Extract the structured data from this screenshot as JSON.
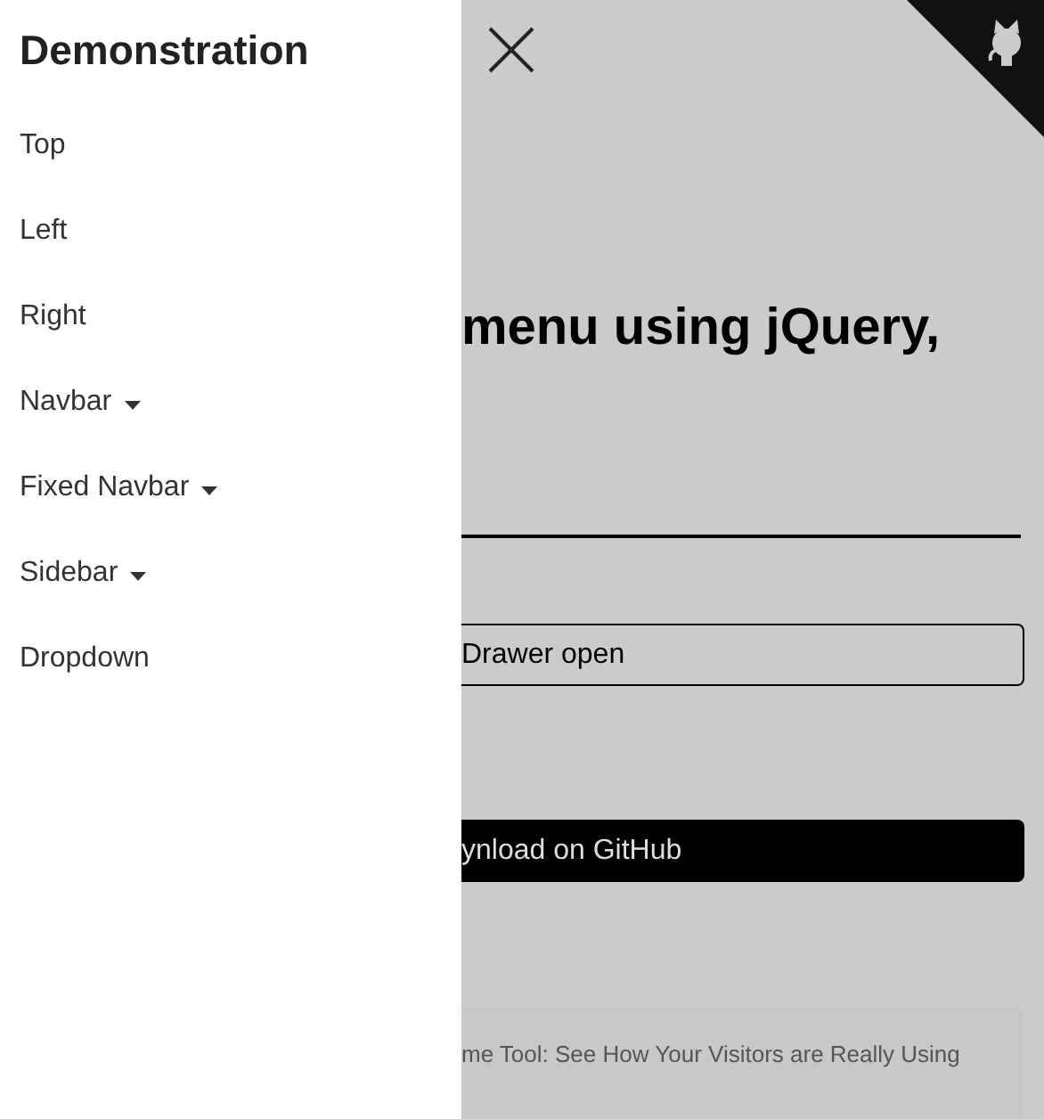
{
  "drawer": {
    "title": "Demonstration",
    "items": [
      {
        "label": "Top",
        "kind": "link"
      },
      {
        "label": "Left",
        "kind": "link"
      },
      {
        "label": "Right",
        "kind": "link"
      },
      {
        "label": "Navbar",
        "kind": "dropdown"
      },
      {
        "label": "Fixed Navbar",
        "kind": "dropdown"
      },
      {
        "label": "Sidebar",
        "kind": "dropdown"
      },
      {
        "label": "Dropdown",
        "kind": "link"
      }
    ]
  },
  "page": {
    "heading": "menu using jQuery,",
    "toggle_button": "Drawer open",
    "download_button": "ynload on GitHub",
    "footer_text": "me Tool: See How Your Visitors are Really Using"
  }
}
